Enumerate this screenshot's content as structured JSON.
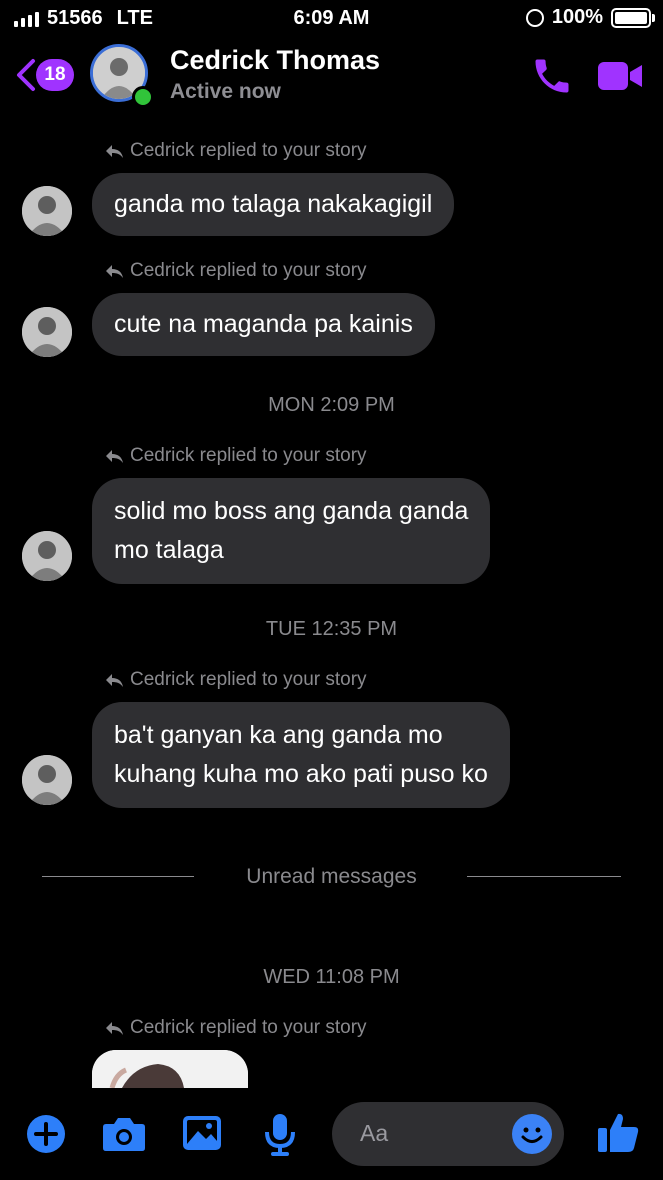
{
  "status_bar": {
    "carrier": "51566",
    "network": "LTE",
    "time": "6:09 AM",
    "battery": "100%"
  },
  "header": {
    "unread_count": "18",
    "contact_name": "Cedrick Thomas",
    "presence": "Active now"
  },
  "messages": [
    {
      "note": "Cedrick replied to your story",
      "text": "ganda mo talaga nakakagigil"
    },
    {
      "note": "Cedrick replied to your story",
      "text": "cute na maganda pa kainis"
    },
    {
      "timestamp": "MON 2:09 PM"
    },
    {
      "note": "Cedrick replied to your story",
      "line1": "solid mo boss ang ganda ganda",
      "line2": "mo talaga"
    },
    {
      "timestamp": "TUE 12:35 PM"
    },
    {
      "note": "Cedrick replied to your story",
      "line1": "ba't ganyan ka ang ganda mo",
      "line2": "kuhang kuha mo ako pati puso ko"
    },
    {
      "divider": "Unread messages"
    },
    {
      "timestamp": "WED 11:08 PM"
    },
    {
      "note": "Cedrick replied to your story"
    }
  ],
  "composer": {
    "placeholder": "Aa"
  },
  "colors": {
    "accent": "#a033ff",
    "action_blue": "#2d7ff9",
    "bubble": "#2f2f32",
    "online": "#31c43a"
  },
  "icons": [
    "back-chevron-icon",
    "phone-icon",
    "video-camera-icon",
    "plus-icon",
    "camera-icon",
    "gallery-icon",
    "microphone-icon",
    "emoji-icon",
    "thumbs-up-icon",
    "reply-arrow-icon"
  ]
}
